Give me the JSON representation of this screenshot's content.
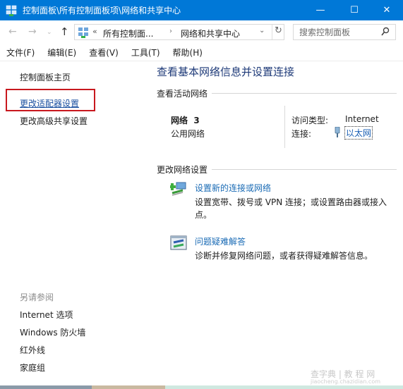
{
  "window": {
    "title": "控制面板\\所有控制面板项\\网络和共享中心",
    "controls": {
      "minimize": "—",
      "maximize": "☐",
      "close": "✕"
    }
  },
  "nav": {
    "back": "←",
    "forward": "→",
    "recent": "⌄",
    "up": "↑",
    "address": {
      "prefix": "«",
      "crumbs": [
        "所有控制面...",
        "网络和共享中心"
      ],
      "separator": "›",
      "dropdown": "⌄",
      "refresh": "↻"
    },
    "search": {
      "placeholder": "搜索控制面板",
      "value": ""
    }
  },
  "menu": [
    "文件(F)",
    "编辑(E)",
    "查看(V)",
    "工具(T)",
    "帮助(H)"
  ],
  "sidebar": {
    "links": [
      "控制面板主页",
      "更改适配器设置",
      "更改高级共享设置"
    ],
    "highlighted_index": 1,
    "highlight_color": "#c8181e",
    "see_also_title": "另请参阅",
    "see_also": [
      "Internet 选项",
      "Windows 防火墙",
      "红外线",
      "家庭组"
    ]
  },
  "main": {
    "title": "查看基本网络信息并设置连接",
    "active_section": "查看活动网络",
    "network": {
      "name": "网络  3",
      "type": "公用网络",
      "access_label": "访问类型:",
      "access_value": "Internet",
      "connection_label": "连接:",
      "connection_value": "以太网"
    },
    "change_section": "更改网络设置",
    "tasks": [
      {
        "icon": "new-connection-icon",
        "title": "设置新的连接或网络",
        "desc": "设置宽带、拨号或 VPN 连接；或设置路由器或接入点。"
      },
      {
        "icon": "troubleshoot-icon",
        "title": "问题疑难解答",
        "desc": "诊断并修复网络问题，或者获得疑难解答信息。"
      }
    ]
  },
  "watermark": {
    "main": "查字典 | 教 程 网",
    "sub": "jiaocheng.chazidian.com"
  },
  "colors": {
    "titlebar": "#0078d7",
    "heading": "#1e3a78",
    "link": "#1a6bb5"
  }
}
